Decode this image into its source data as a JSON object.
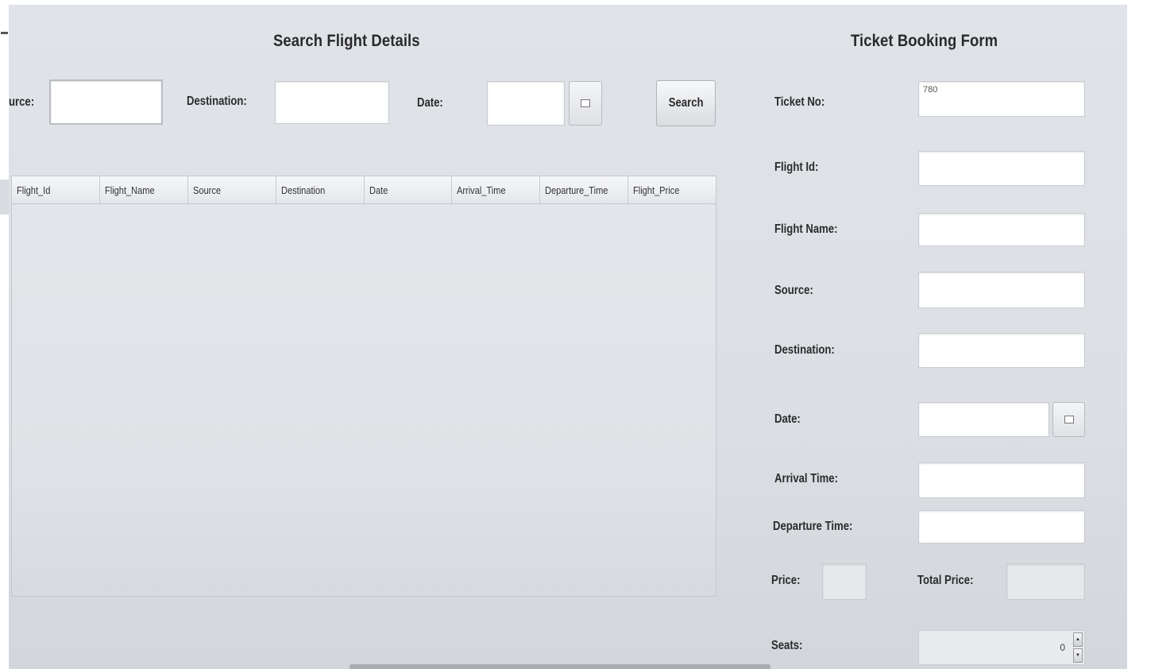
{
  "search": {
    "title": "Search Flight Details",
    "source_label": "urce:",
    "destination_label": "Destination:",
    "date_label": "Date:",
    "search_button": "Search"
  },
  "table": {
    "columns": [
      "Flight_Id",
      "Flight_Name",
      "Source",
      "Destination",
      "Date",
      "Arrival_Time",
      "Departure_Time",
      "Flight_Price"
    ]
  },
  "booking": {
    "title": "Ticket Booking Form",
    "ticket_no_label": "Ticket No:",
    "ticket_no_value": "780",
    "flight_id_label": "Flight Id:",
    "flight_name_label": "Flight Name:",
    "source_label": "Source:",
    "destination_label": "Destination:",
    "date_label": "Date:",
    "arrival_label": "Arrival Time:",
    "departure_label": "Departure Time:",
    "price_label": "Price:",
    "total_price_label": "Total Price:",
    "seats_label": "Seats:",
    "seats_value": "0"
  }
}
